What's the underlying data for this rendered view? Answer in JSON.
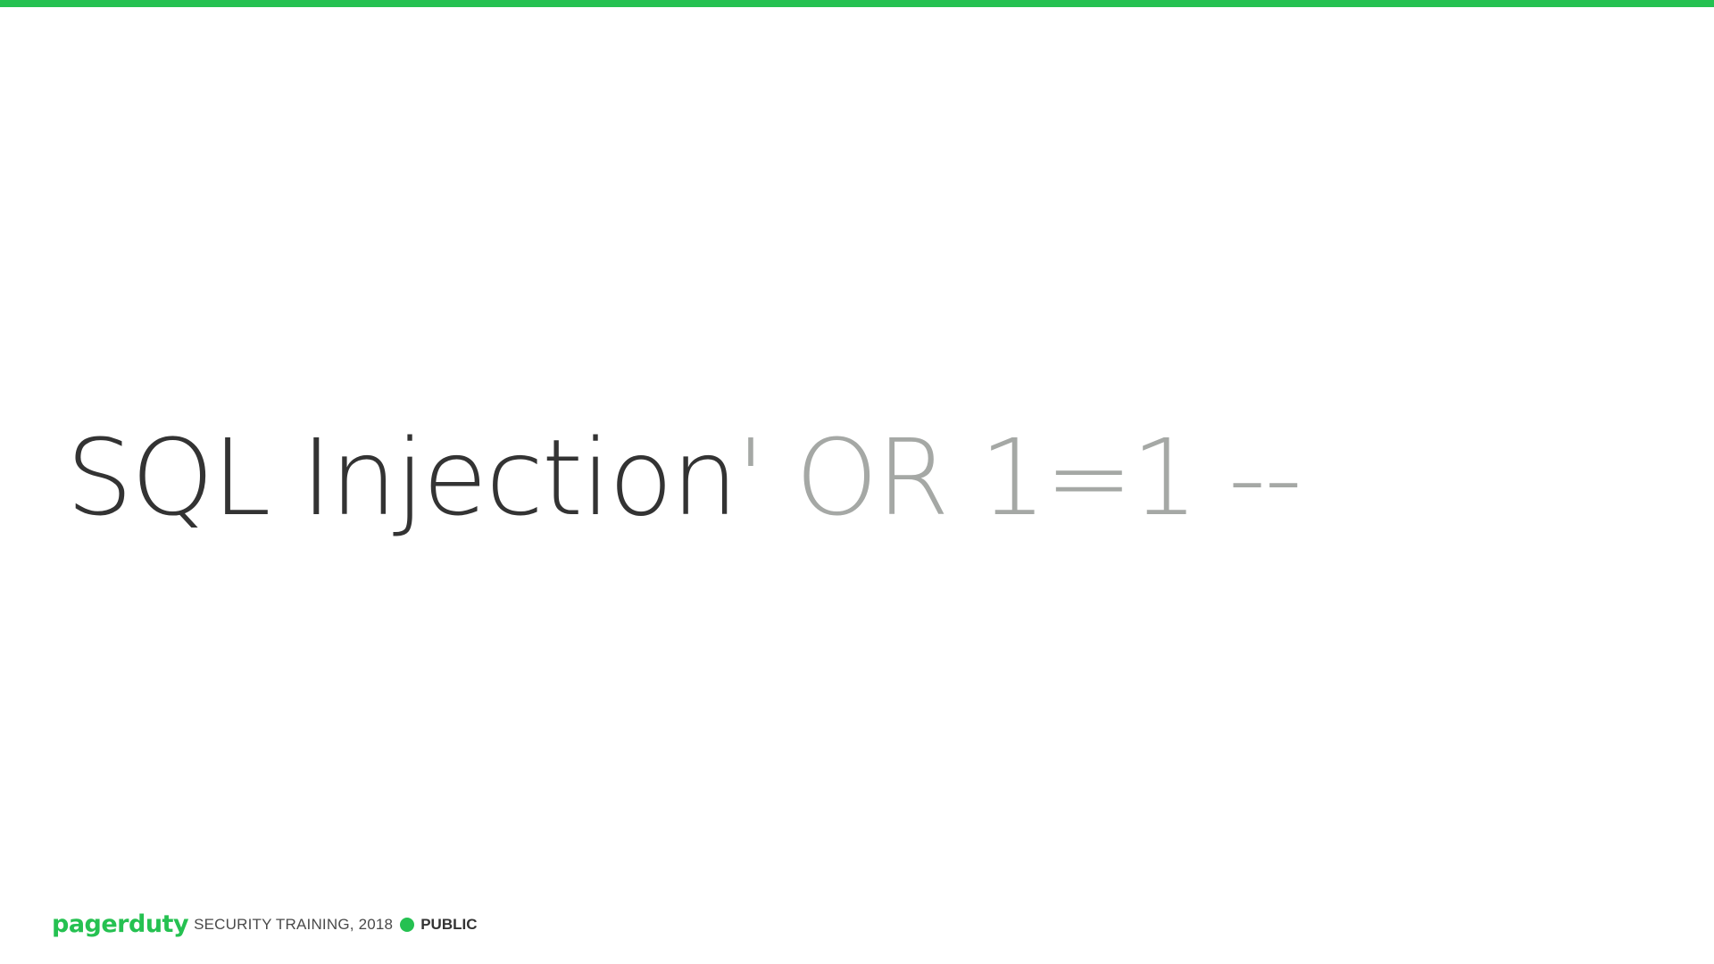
{
  "slide": {
    "title_main": "SQL Injection",
    "title_quote": "'",
    "title_payload": " OR 1=1 --"
  },
  "footer": {
    "logo_text": "pagerduty",
    "course_text": "SECURITY TRAINING, 2018",
    "classification": "PUBLIC"
  },
  "colors": {
    "accent_green": "#25c151",
    "title_dark": "#333333",
    "payload_gray": "#a5a8a5"
  }
}
